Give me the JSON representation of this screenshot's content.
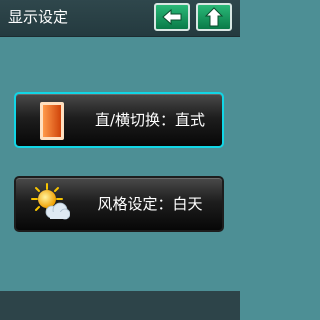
{
  "header": {
    "title": "显示设定"
  },
  "nav": {
    "back_icon": "arrow-left-icon",
    "up_icon": "arrow-up-icon"
  },
  "settings": [
    {
      "label": "直/横切换：直式",
      "icon": "portrait-orientation-icon",
      "selected": true
    },
    {
      "label": "风格设定：白天",
      "icon": "sun-cloud-icon",
      "selected": false
    }
  ],
  "colors": {
    "background": "#4d8f95",
    "header": "#2c4449",
    "nav_button": "#1a9e62",
    "selected_border": "#12d6e6"
  }
}
